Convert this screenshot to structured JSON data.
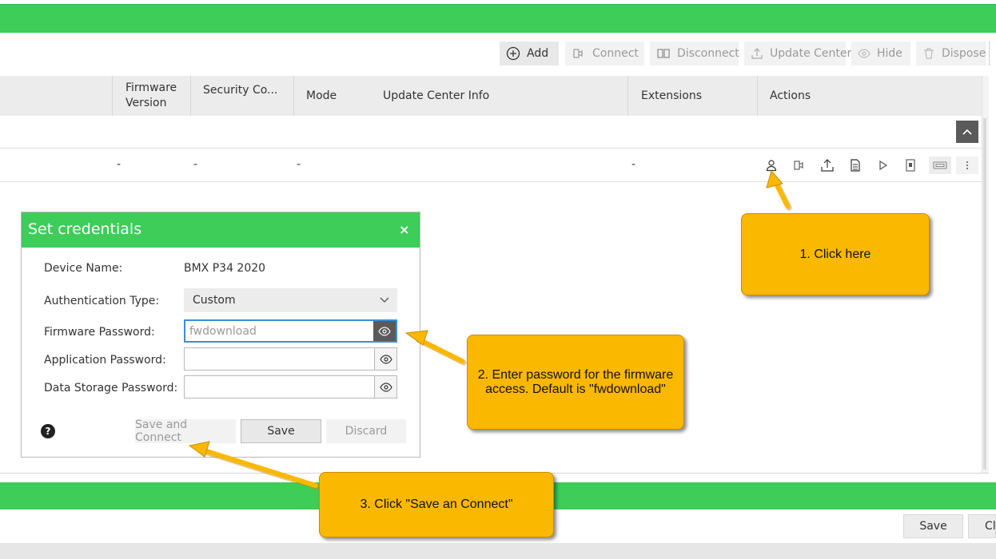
{
  "toolbar": {
    "add": "Add",
    "connect": "Connect",
    "disconnect": "Disconnect",
    "update_center": "Update Center",
    "hide": "Hide",
    "dispose": "Dispose"
  },
  "table": {
    "columns": {
      "firmware_version_1": "Firmware",
      "firmware_version_2": "Version",
      "security": "Security Co...",
      "mode": "Mode",
      "update_center_info": "Update Center Info",
      "extensions": "Extensions",
      "actions": "Actions"
    },
    "row": {
      "firmware_version": "-",
      "security": "-",
      "mode": "-",
      "extensions": "-"
    }
  },
  "dialog": {
    "title": "Set credentials",
    "close": "×",
    "device_name_label": "Device Name:",
    "device_name_value": "BMX P34 2020",
    "auth_type_label": "Authentication Type:",
    "auth_type_value": "Custom",
    "firmware_password_label": "Firmware Password:",
    "firmware_password_placeholder": "fwdownload",
    "application_password_label": "Application Password:",
    "data_storage_password_label": "Data Storage Password:",
    "help": "?",
    "save_and_connect": "Save and Connect",
    "save": "Save",
    "discard": "Discard"
  },
  "callouts": {
    "step1": "1. Click here",
    "step2_line1": "2. Enter password for the firmware",
    "step2_line2": "access. Default is \"fwdownload\"",
    "step3": "3. Click \"Save an Connect\""
  },
  "footer": {
    "save": "Save",
    "close_partial": "Cl"
  },
  "colors": {
    "brand_green": "#3dcd58",
    "callout_yellow": "#fbb800",
    "focus_blue": "#3b8fd8"
  }
}
